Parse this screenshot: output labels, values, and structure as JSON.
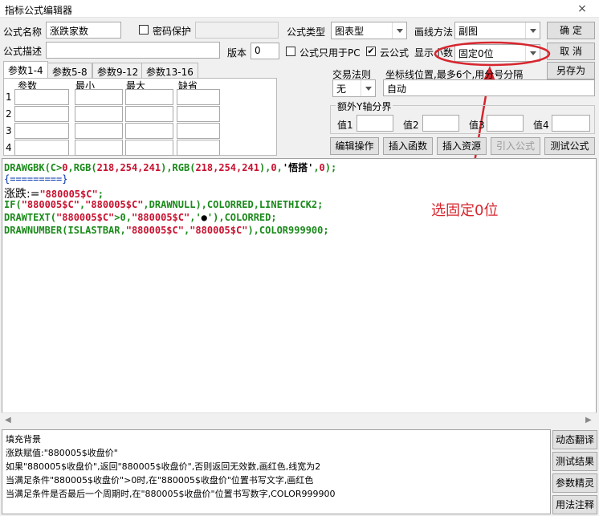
{
  "window": {
    "title": "指标公式编辑器",
    "close": "×"
  },
  "form": {
    "name_label": "公式名称",
    "name_value": "涨跌家数",
    "password_label": "密码保护",
    "type_label": "公式类型",
    "type_value": "图表型",
    "draw_label": "画线方法",
    "draw_value": "副图",
    "desc_label": "公式描述",
    "version_label": "版本",
    "version_value": "0",
    "pc_only_label": "公式只用于PC",
    "pc_only_checked": false,
    "cloud_label": "云公式",
    "cloud_checked": true,
    "cloud_mark": "✔",
    "decimals_label": "显示小数",
    "decimals_value": "固定0位"
  },
  "buttons": {
    "ok": "确  定",
    "cancel": "取  消",
    "save_as": "另存为",
    "edit_op": "编辑操作",
    "insert_func": "插入函数",
    "insert_res": "插入资源",
    "import": "引入公式",
    "test": "测试公式"
  },
  "tabs": [
    "参数1-4",
    "参数5-8",
    "参数9-12",
    "参数13-16"
  ],
  "param_headers": [
    "参数",
    "最小",
    "最大",
    "缺省"
  ],
  "param_rows": [
    "1",
    "2",
    "3",
    "4"
  ],
  "trade": {
    "label": "交易法则",
    "value": "无"
  },
  "coord": {
    "label": "坐标线位置,最多6个,用分号分隔",
    "value": "自动"
  },
  "yaxis": {
    "label": "额外Y轴分界",
    "v1": "值1",
    "v2": "值2",
    "v3": "值3",
    "v4": "值4"
  },
  "code": {
    "l1": [
      [
        "DRAWGBK(C>",
        "g"
      ],
      [
        "0",
        "r"
      ],
      [
        ",RGB(",
        "g"
      ],
      [
        "218,254,241",
        "r"
      ],
      [
        "),RGB(",
        "g"
      ],
      [
        "218,254,241",
        "r"
      ],
      [
        "),",
        "g"
      ],
      [
        "0",
        "r"
      ],
      [
        ",",
        "g"
      ],
      [
        "'悟搭'",
        "k"
      ],
      [
        ",",
        "g"
      ],
      [
        "0",
        "r"
      ],
      [
        ");",
        "g"
      ]
    ],
    "l2": "{=========}",
    "l3a": "涨跌:=",
    "l3b": "\"880005$C\"",
    "l3c": ";",
    "l4": [
      [
        "IF(",
        "g"
      ],
      [
        "\"880005$C\"",
        "r"
      ],
      [
        ",",
        "g"
      ],
      [
        "\"880005$C\"",
        "r"
      ],
      [
        ",DRAWNULL),COLORRED,LINETHICK2;",
        "g"
      ]
    ],
    "l5": [
      [
        "DRAWTEXT(",
        "g"
      ],
      [
        "\"880005$C\"",
        "r"
      ],
      [
        ">0,",
        "g"
      ],
      [
        "\"880005$C\"",
        "r"
      ],
      [
        ",'",
        "g"
      ],
      [
        "●",
        "k"
      ],
      [
        "'),COLORRED;",
        "g"
      ]
    ],
    "l6": [
      [
        "DRAWNUMBER(ISLASTBAR,",
        "g"
      ],
      [
        "\"880005$C\"",
        "r"
      ],
      [
        ",",
        "g"
      ],
      [
        "\"880005$C\"",
        "r"
      ],
      [
        "),COLOR999900;",
        "g"
      ]
    ]
  },
  "desc_lines": [
    "填充背景",
    "涨跌赋值:\"880005$收盘价\"",
    "如果\"880005$收盘价\",返回\"880005$收盘价\",否则返回无效数,画红色,线宽为2",
    "当满足条件\"880005$收盘价\">0时,在\"880005$收盘价\"位置书写文字,画红色",
    "当满足条件是否最后一个周期时,在\"880005$收盘价\"位置书写数字,COLOR999900"
  ],
  "side_buttons": [
    "动态翻译",
    "测试结果",
    "参数精灵",
    "用法注释"
  ],
  "annotation": "选固定0位",
  "colors": {
    "annotation": "#d7262e",
    "code_green": "#1a8a1a",
    "code_red": "#c8102e"
  }
}
